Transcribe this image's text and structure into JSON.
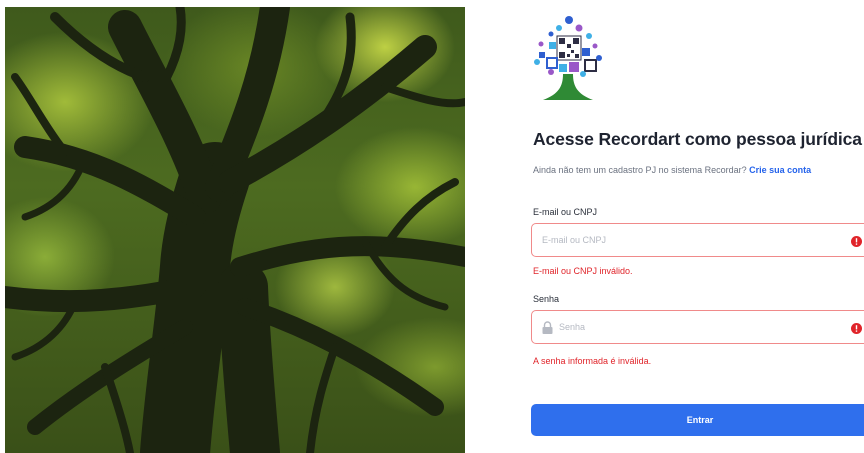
{
  "hero": {
    "image_name": "tree-canopy-photo"
  },
  "brand": {
    "logo_name": "recordart-tree-qr-logo"
  },
  "login": {
    "title": "Acesse Recordart como pessoa jurídica",
    "subtitle_text": "Ainda não tem um cadastro PJ no sistema Recordar?",
    "create_account_link": "Crie sua conta",
    "email": {
      "label": "E-mail ou CNPJ",
      "placeholder": "E-mail ou CNPJ",
      "value": "",
      "error": "E-mail ou CNPJ inválido."
    },
    "password": {
      "label": "Senha",
      "placeholder": "Senha",
      "value": "",
      "error": "A senha informada é inválida."
    },
    "submit_label": "Entrar"
  },
  "colors": {
    "primary": "#2f6fed",
    "error": "#e0242a",
    "error_border": "#f08a8a",
    "link": "#2563eb"
  }
}
